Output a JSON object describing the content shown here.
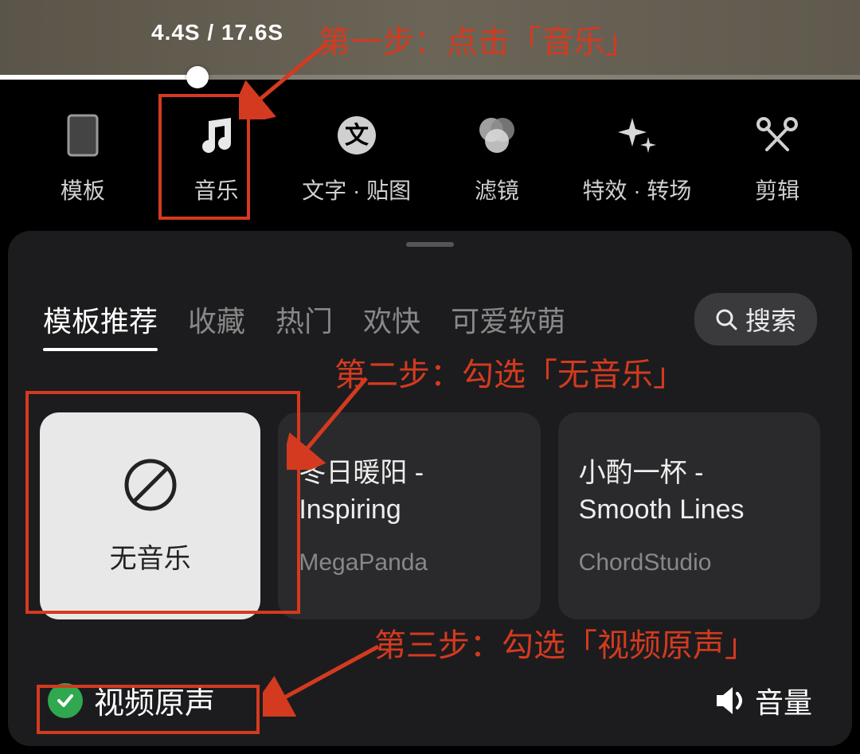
{
  "timeline": {
    "time_display": "4.4S / 17.6S"
  },
  "toolbar": {
    "items": [
      {
        "label": "模板"
      },
      {
        "label": "音乐"
      },
      {
        "label": "文字 · 贴图"
      },
      {
        "label": "滤镜"
      },
      {
        "label": "特效 · 转场"
      },
      {
        "label": "剪辑"
      }
    ]
  },
  "music_panel": {
    "categories": [
      {
        "label": "模板推荐",
        "active": true
      },
      {
        "label": "收藏"
      },
      {
        "label": "热门"
      },
      {
        "label": "欢快"
      },
      {
        "label": "可爱软萌"
      }
    ],
    "search_label": "搜索",
    "cards": {
      "none_label": "无音乐",
      "tracks": [
        {
          "title": "冬日暖阳 - Inspiring",
          "artist": "MegaPanda"
        },
        {
          "title": "小酌一杯 - Smooth Lines",
          "artist": "ChordStudio"
        }
      ]
    },
    "original_sound_label": "视频原声",
    "volume_label": "音量"
  },
  "annotations": {
    "step1": "第一步：点击「音乐」",
    "step2": "第二步：勾选「无音乐」",
    "step3": "第三步：勾选「视频原声」"
  }
}
